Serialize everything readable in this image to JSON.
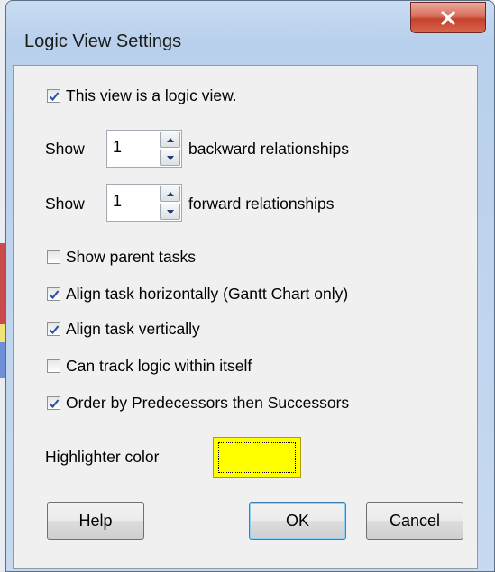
{
  "dialog": {
    "title": "Logic View Settings",
    "close_icon": "close-icon"
  },
  "options": {
    "logic_view": {
      "label": "This view is a logic view.",
      "checked": true
    },
    "backward": {
      "prefix": "Show",
      "value": "1",
      "suffix": "backward relationships"
    },
    "forward": {
      "prefix": "Show",
      "value": "1",
      "suffix": "forward relationships"
    },
    "checkboxes": [
      {
        "label": "Show parent tasks",
        "checked": false
      },
      {
        "label": "Align task horizontally (Gantt Chart only)",
        "checked": true
      },
      {
        "label": "Align task vertically",
        "checked": true
      },
      {
        "label": "Can track logic within itself",
        "checked": false
      },
      {
        "label": "Order by Predecessors then Successors",
        "checked": true
      }
    ],
    "highlighter": {
      "label": "Highlighter color",
      "color": "#ffff00"
    }
  },
  "buttons": {
    "help": "Help",
    "ok": "OK",
    "cancel": "Cancel"
  }
}
